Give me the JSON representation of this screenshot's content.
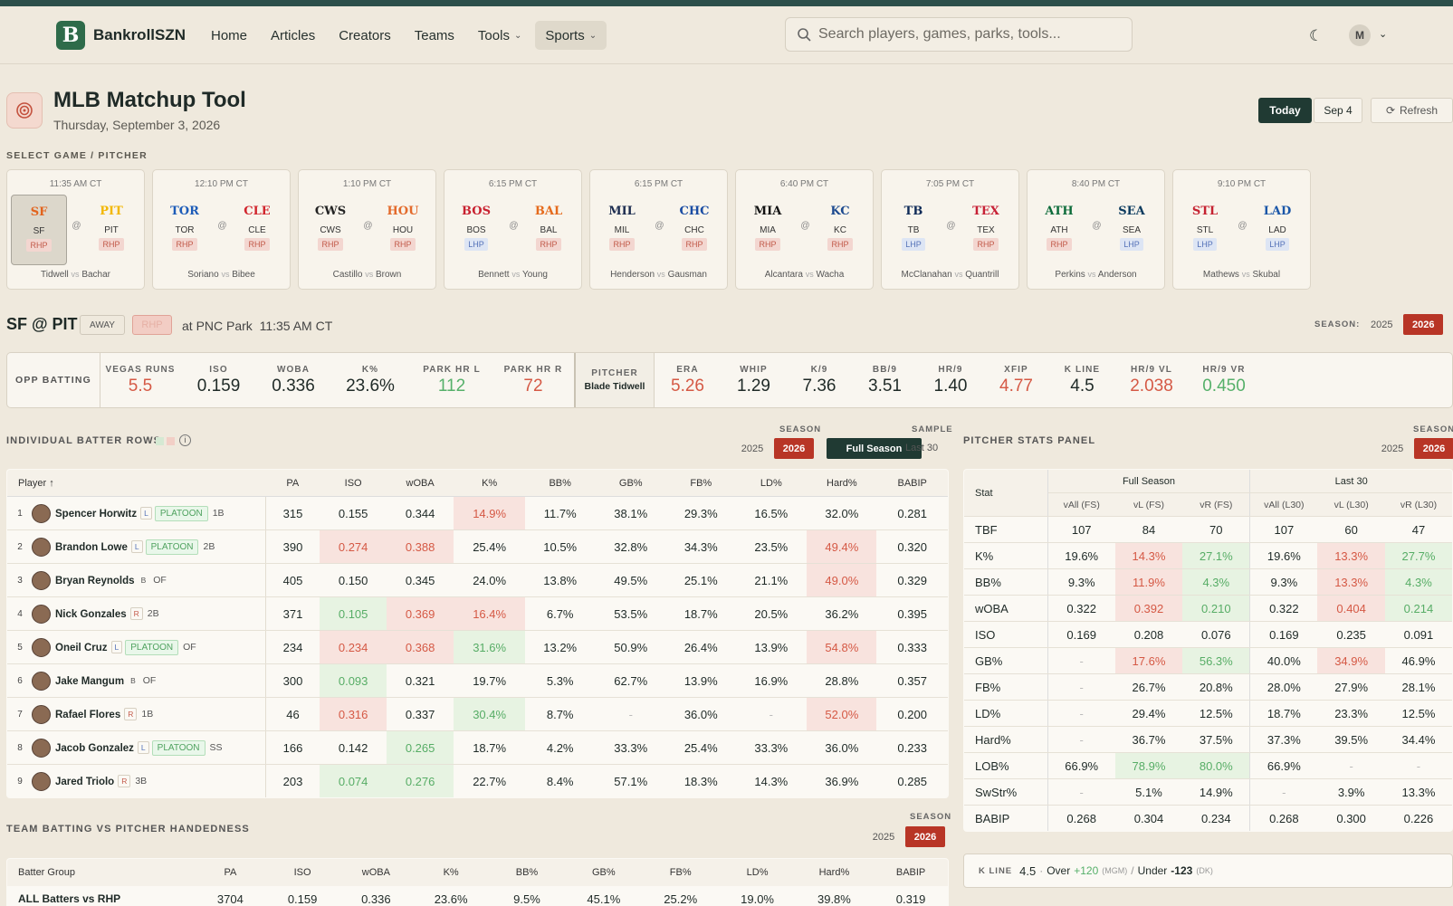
{
  "brand": "BankrollSZN",
  "brand_letter": "B",
  "nav": {
    "home": "Home",
    "articles": "Articles",
    "creators": "Creators",
    "teams": "Teams",
    "tools": "Tools",
    "sports": "Sports"
  },
  "search_placeholder": "Search players, games, parks, tools...",
  "user_initial": "M",
  "page": {
    "title": "MLB Matchup Tool",
    "date": "Thursday, September 3, 2026",
    "today": "Today",
    "sep4": "Sep 4",
    "refresh": "Refresh"
  },
  "select_label": "SELECT GAME / PITCHER",
  "games": [
    {
      "time": "11:35 AM CT",
      "away": "SF",
      "home": "PIT",
      "away_hand": "RHP",
      "home_hand": "RHP",
      "away_p": "Tidwell",
      "home_p": "Bachar",
      "away_color": "#e2631d",
      "home_color": "#f2b705"
    },
    {
      "time": "12:10 PM CT",
      "away": "TOR",
      "home": "CLE",
      "away_hand": "RHP",
      "home_hand": "RHP",
      "away_p": "Soriano",
      "home_p": "Bibee",
      "away_color": "#1d5cb8",
      "home_color": "#d1252d"
    },
    {
      "time": "1:10 PM CT",
      "away": "CWS",
      "home": "HOU",
      "away_hand": "RHP",
      "home_hand": "RHP",
      "away_p": "Castillo",
      "home_p": "Brown",
      "away_color": "#222222",
      "home_color": "#e36a2b"
    },
    {
      "time": "6:15 PM CT",
      "away": "BOS",
      "home": "BAL",
      "away_hand": "LHP",
      "home_hand": "RHP",
      "away_p": "Bennett",
      "home_p": "Young",
      "away_color": "#c8202f",
      "home_color": "#e56a1c"
    },
    {
      "time": "6:15 PM CT",
      "away": "MIL",
      "home": "CHC",
      "away_hand": "RHP",
      "home_hand": "RHP",
      "away_p": "Henderson",
      "home_p": "Gausman",
      "away_color": "#1b2b4f",
      "home_color": "#1a4ca3"
    },
    {
      "time": "6:40 PM CT",
      "away": "MIA",
      "home": "KC",
      "away_hand": "RHP",
      "home_hand": "RHP",
      "away_p": "Alcantara",
      "home_p": "Wacha",
      "away_color": "#111111",
      "home_color": "#1d4a8f"
    },
    {
      "time": "7:05 PM CT",
      "away": "TB",
      "home": "TEX",
      "away_hand": "LHP",
      "home_hand": "RHP",
      "away_p": "McClanahan",
      "home_p": "Quantrill",
      "away_color": "#0e2a57",
      "home_color": "#c72136"
    },
    {
      "time": "8:40 PM CT",
      "away": "ATH",
      "home": "SEA",
      "away_hand": "RHP",
      "home_hand": "LHP",
      "away_p": "Perkins",
      "home_p": "Anderson",
      "away_color": "#0c6b3a",
      "home_color": "#0b3a5e"
    },
    {
      "time": "9:10 PM CT",
      "away": "STL",
      "home": "LAD",
      "away_hand": "LHP",
      "home_hand": "LHP",
      "away_p": "Mathews",
      "home_p": "Skubal",
      "away_color": "#c52130",
      "home_color": "#1a56a8"
    }
  ],
  "vs": "vs",
  "at": "@",
  "matchup": {
    "title": "SF @ PIT",
    "away": "AWAY",
    "hand": "RHP",
    "park": "at PNC Park",
    "time": "11:35 AM CT",
    "season_label": "SEASON:",
    "y2025": "2025",
    "y2026": "2026"
  },
  "statbar": {
    "opp": "OPP BATTING",
    "items": [
      {
        "l": "VEGAS RUNS",
        "v": "5.5",
        "c": "red"
      },
      {
        "l": "ISO",
        "v": "0.159",
        "c": ""
      },
      {
        "l": "WOBA",
        "v": "0.336",
        "c": ""
      },
      {
        "l": "K%",
        "v": "23.6%",
        "c": ""
      },
      {
        "l": "PARK HR L",
        "v": "112",
        "c": "green"
      },
      {
        "l": "PARK HR R",
        "v": "72",
        "c": "red"
      }
    ],
    "pitcher_label": "PITCHER",
    "pitcher_name": "Blade Tidwell",
    "pitems": [
      {
        "l": "ERA",
        "v": "5.26",
        "c": "red"
      },
      {
        "l": "WHIP",
        "v": "1.29",
        "c": ""
      },
      {
        "l": "K/9",
        "v": "7.36",
        "c": ""
      },
      {
        "l": "BB/9",
        "v": "3.51",
        "c": ""
      },
      {
        "l": "HR/9",
        "v": "1.40",
        "c": ""
      },
      {
        "l": "XFIP",
        "v": "4.77",
        "c": "red"
      },
      {
        "l": "K LINE",
        "v": "4.5",
        "c": ""
      },
      {
        "l": "HR/9 VL",
        "v": "2.038",
        "c": "red"
      },
      {
        "l": "HR/9 VR",
        "v": "0.450",
        "c": "green"
      }
    ]
  },
  "batters": {
    "title": "INDIVIDUAL BATTER ROWS",
    "season": "SEASON",
    "sample": "SAMPLE",
    "full": "Full Season",
    "last30": "Last 30",
    "headers": [
      "Player ↑",
      "PA",
      "ISO",
      "wOBA",
      "K%",
      "BB%",
      "GB%",
      "FB%",
      "LD%",
      "Hard%",
      "BABIP"
    ],
    "rows": [
      {
        "n": "1",
        "name": "Spencer Horwitz",
        "h": "L",
        "plat": "PLATOON",
        "pos": "1B",
        "v": [
          "315",
          "0.155",
          "0.344",
          "14.9%",
          "11.7%",
          "38.1%",
          "29.3%",
          "16.5%",
          "32.0%",
          "0.281"
        ],
        "c": [
          "",
          "",
          "",
          "R",
          "",
          "",
          "",
          "",
          "",
          ""
        ]
      },
      {
        "n": "2",
        "name": "Brandon Lowe",
        "h": "L",
        "plat": "PLATOON",
        "pos": "2B",
        "v": [
          "390",
          "0.274",
          "0.388",
          "25.4%",
          "10.5%",
          "32.8%",
          "34.3%",
          "23.5%",
          "49.4%",
          "0.320"
        ],
        "c": [
          "",
          "R",
          "R",
          "",
          "",
          "",
          "",
          "",
          "R",
          ""
        ]
      },
      {
        "n": "3",
        "name": "Bryan Reynolds",
        "h": "B",
        "plat": "",
        "pos": "OF",
        "v": [
          "405",
          "0.150",
          "0.345",
          "24.0%",
          "13.8%",
          "49.5%",
          "25.1%",
          "21.1%",
          "49.0%",
          "0.329"
        ],
        "c": [
          "",
          "",
          "",
          "",
          "",
          "",
          "",
          "",
          "R",
          ""
        ]
      },
      {
        "n": "4",
        "name": "Nick Gonzales",
        "h": "R",
        "plat": "",
        "pos": "2B",
        "v": [
          "371",
          "0.105",
          "0.369",
          "16.4%",
          "6.7%",
          "53.5%",
          "18.7%",
          "20.5%",
          "36.2%",
          "0.395"
        ],
        "c": [
          "",
          "G",
          "R",
          "R",
          "",
          "",
          "",
          "",
          "",
          ""
        ]
      },
      {
        "n": "5",
        "name": "Oneil Cruz",
        "h": "L",
        "plat": "PLATOON",
        "pos": "OF",
        "v": [
          "234",
          "0.234",
          "0.368",
          "31.6%",
          "13.2%",
          "50.9%",
          "26.4%",
          "13.9%",
          "54.8%",
          "0.333"
        ],
        "c": [
          "",
          "R",
          "R",
          "G",
          "",
          "",
          "",
          "",
          "R",
          ""
        ]
      },
      {
        "n": "6",
        "name": "Jake Mangum",
        "h": "B",
        "plat": "",
        "pos": "OF",
        "v": [
          "300",
          "0.093",
          "0.321",
          "19.7%",
          "5.3%",
          "62.7%",
          "13.9%",
          "16.9%",
          "28.8%",
          "0.357"
        ],
        "c": [
          "",
          "G",
          "",
          "",
          "",
          "",
          "",
          "",
          "",
          ""
        ]
      },
      {
        "n": "7",
        "name": "Rafael Flores",
        "h": "R",
        "plat": "",
        "pos": "1B",
        "v": [
          "46",
          "0.316",
          "0.337",
          "30.4%",
          "8.7%",
          "-",
          "36.0%",
          "-",
          "52.0%",
          "0.200"
        ],
        "c": [
          "",
          "R",
          "",
          "G",
          "",
          "M",
          "",
          "M",
          "R",
          ""
        ]
      },
      {
        "n": "8",
        "name": "Jacob Gonzalez",
        "h": "L",
        "plat": "PLATOON",
        "pos": "SS",
        "v": [
          "166",
          "0.142",
          "0.265",
          "18.7%",
          "4.2%",
          "33.3%",
          "25.4%",
          "33.3%",
          "36.0%",
          "0.233"
        ],
        "c": [
          "",
          "",
          "G",
          "",
          "",
          "",
          "",
          "",
          "",
          ""
        ]
      },
      {
        "n": "9",
        "name": "Jared Triolo",
        "h": "R",
        "plat": "",
        "pos": "3B",
        "v": [
          "203",
          "0.074",
          "0.276",
          "22.7%",
          "8.4%",
          "57.1%",
          "18.3%",
          "14.3%",
          "36.9%",
          "0.285"
        ],
        "c": [
          "",
          "G",
          "G",
          "",
          "",
          "",
          "",
          "",
          "",
          ""
        ]
      }
    ]
  },
  "pstats": {
    "title": "PITCHER STATS PANEL",
    "season": "SEASON",
    "stat": "Stat",
    "fs": "Full Season",
    "l30": "Last 30",
    "sub": [
      "vAll (FS)",
      "vL (FS)",
      "vR (FS)",
      "vAll (L30)",
      "vL (L30)",
      "vR (L30)"
    ],
    "rows": [
      {
        "s": "TBF",
        "v": [
          "107",
          "84",
          "70",
          "107",
          "60",
          "47"
        ],
        "c": [
          "",
          "",
          "",
          "",
          "",
          ""
        ]
      },
      {
        "s": "K%",
        "v": [
          "19.6%",
          "14.3%",
          "27.1%",
          "19.6%",
          "13.3%",
          "27.7%"
        ],
        "c": [
          "",
          "R",
          "G",
          "",
          "R",
          "G"
        ]
      },
      {
        "s": "BB%",
        "v": [
          "9.3%",
          "11.9%",
          "4.3%",
          "9.3%",
          "13.3%",
          "4.3%"
        ],
        "c": [
          "",
          "R",
          "G",
          "",
          "R",
          "G"
        ]
      },
      {
        "s": "wOBA",
        "v": [
          "0.322",
          "0.392",
          "0.210",
          "0.322",
          "0.404",
          "0.214"
        ],
        "c": [
          "",
          "R",
          "G",
          "",
          "R",
          "G"
        ]
      },
      {
        "s": "ISO",
        "v": [
          "0.169",
          "0.208",
          "0.076",
          "0.169",
          "0.235",
          "0.091"
        ],
        "c": [
          "",
          "",
          "",
          "",
          "",
          ""
        ]
      },
      {
        "s": "GB%",
        "v": [
          "-",
          "17.6%",
          "56.3%",
          "40.0%",
          "34.9%",
          "46.9%"
        ],
        "c": [
          "M",
          "R",
          "G",
          "",
          "R",
          ""
        ]
      },
      {
        "s": "FB%",
        "v": [
          "-",
          "26.7%",
          "20.8%",
          "28.0%",
          "27.9%",
          "28.1%"
        ],
        "c": [
          "M",
          "",
          "",
          "",
          "",
          ""
        ]
      },
      {
        "s": "LD%",
        "v": [
          "-",
          "29.4%",
          "12.5%",
          "18.7%",
          "23.3%",
          "12.5%"
        ],
        "c": [
          "M",
          "",
          "",
          "",
          "",
          ""
        ]
      },
      {
        "s": "Hard%",
        "v": [
          "-",
          "36.7%",
          "37.5%",
          "37.3%",
          "39.5%",
          "34.4%"
        ],
        "c": [
          "M",
          "",
          "",
          "",
          "",
          ""
        ]
      },
      {
        "s": "LOB%",
        "v": [
          "66.9%",
          "78.9%",
          "80.0%",
          "66.9%",
          "-",
          "-"
        ],
        "c": [
          "",
          "G",
          "G",
          "",
          "M",
          "M"
        ]
      },
      {
        "s": "SwStr%",
        "v": [
          "-",
          "5.1%",
          "14.9%",
          "-",
          "3.9%",
          "13.3%"
        ],
        "c": [
          "M",
          "",
          "",
          "M",
          "",
          ""
        ]
      },
      {
        "s": "BABIP",
        "v": [
          "0.268",
          "0.304",
          "0.234",
          "0.268",
          "0.300",
          "0.226"
        ],
        "c": [
          "",
          "",
          "",
          "",
          "",
          ""
        ]
      }
    ]
  },
  "team": {
    "title": "TEAM BATTING VS PITCHER HANDEDNESS",
    "season": "SEASON",
    "headers": [
      "Batter Group",
      "PA",
      "ISO",
      "wOBA",
      "K%",
      "BB%",
      "GB%",
      "FB%",
      "LD%",
      "Hard%",
      "BABIP"
    ],
    "row": [
      "ALL Batters vs RHP",
      "3704",
      "0.159",
      "0.336",
      "23.6%",
      "9.5%",
      "45.1%",
      "25.2%",
      "19.0%",
      "39.8%",
      "0.319"
    ]
  },
  "kline": {
    "label": "K LINE",
    "val": "4.5",
    "over": "Over",
    "over_odds": "+120",
    "mgm": "(MGM)",
    "slash": "/",
    "under": "Under",
    "under_odds": "-123",
    "dk": "(DK)"
  }
}
